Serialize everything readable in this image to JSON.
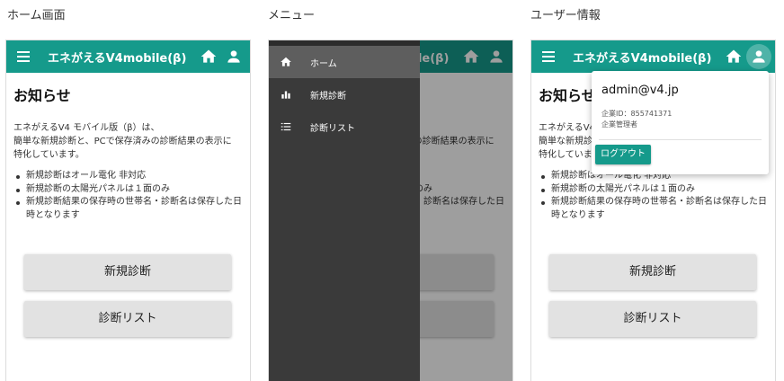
{
  "captions": [
    "ホーム画面",
    "メニュー",
    "ユーザー情報"
  ],
  "app": {
    "title": "エネがえるV4mobile(β)",
    "accent": "#159a8b"
  },
  "notice": {
    "title": "お知らせ",
    "intro": [
      "エネがえるV4 モバイル版（β）は、",
      "簡単な新規診断と、PCで保存済みの診断結果の表示に",
      "特化しています。"
    ],
    "bullets": [
      "新規診断はオール電化 非対応",
      "新規診断の太陽光パネルは１面のみ",
      "新規診断結果の保存時の世帯名・診断名は保存した日時となります"
    ]
  },
  "buttons": {
    "new_diagnosis": "新規診断",
    "diagnosis_list": "診断リスト"
  },
  "drawer": {
    "items": [
      {
        "label": "ホーム",
        "icon": "home-icon",
        "selected": true
      },
      {
        "label": "新規診断",
        "icon": "bar-chart-icon",
        "selected": false
      },
      {
        "label": "診断リスト",
        "icon": "list-icon",
        "selected": false
      }
    ]
  },
  "user": {
    "email": "admin@v4.jp",
    "company_id": "企業ID：855741371",
    "role": "企業管理者",
    "logout_label": "ログアウト"
  }
}
